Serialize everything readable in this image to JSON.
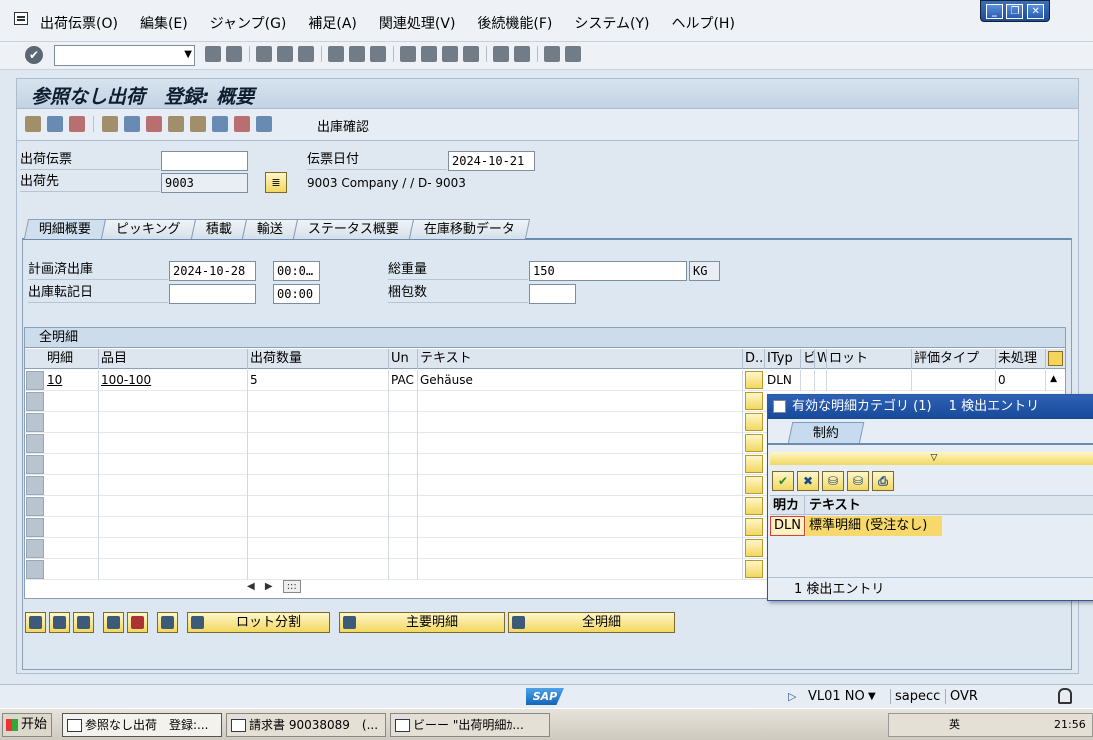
{
  "menu": {
    "items": [
      "出荷伝票(O)",
      "編集(E)",
      "ジャンプ(G)",
      "補足(A)",
      "関連処理(V)",
      "後続機能(F)",
      "システム(Y)",
      "ヘルプ(H)"
    ]
  },
  "window_controls": [
    "_",
    "❐",
    "✕"
  ],
  "page": {
    "title": "参照なし出荷　登録: 概要",
    "app_toolbar_label": "出庫確認"
  },
  "header": {
    "delivery_label": "出荷伝票",
    "delivery_value": "",
    "ship_to_label": "出荷先",
    "ship_to_value": "9003",
    "ship_to_text": "9003 Company / / D- 9003",
    "doc_date_label": "伝票日付",
    "doc_date_value": "2024-10-21"
  },
  "tabs": [
    "明細概要",
    "ピッキング",
    "積載",
    "輸送",
    "ステータス概要",
    "在庫移動データ"
  ],
  "overview": {
    "planned_gi_label": "計画済出庫",
    "planned_gi_date": "2024-10-28",
    "planned_gi_time": "00:0…",
    "actual_gi_label": "出庫転記日",
    "actual_gi_date": "",
    "actual_gi_time": "00:00",
    "total_weight_label": "総重量",
    "total_weight_value": "150",
    "weight_unit": "KG",
    "packages_label": "梱包数",
    "packages_value": ""
  },
  "table": {
    "caption": "全明細",
    "columns": [
      "明細",
      "品目",
      "出荷数量",
      "Un",
      "テキスト",
      "D..",
      "ITyp",
      "ビ",
      "W",
      "ロット",
      "評価タイプ",
      "未処理"
    ],
    "rows": [
      {
        "item": "10",
        "material": "100-100",
        "qty": "5",
        "unit": "PAC",
        "text": "Gehäuse",
        "itype": "DLN",
        "open": "0"
      }
    ],
    "scroll": [
      "◀",
      "▶",
      ":::"
    ],
    "up_arrow": "▲"
  },
  "buttons": {
    "batch_split": "ロット分割",
    "main_items": "主要明細",
    "all_items": "全明細"
  },
  "popup": {
    "title": "有効な明細カテゴリ (1)　 1 検出エントリ",
    "tab": "制約",
    "filter_glyph": "▽",
    "tools": [
      "✔",
      "✖",
      "⛁",
      "⛁",
      "⎙"
    ],
    "col_key": "明カ",
    "col_text": "テキスト",
    "row_key": "DLN",
    "row_text": "標準明細 (受注なし)",
    "status": "1 検出エントリ"
  },
  "statusbar": {
    "sap_logo": "SAP",
    "system": "VL01 NO",
    "client_arrow": "▼",
    "server": "sapecc",
    "mode": "OVR",
    "play_glyph": "▷"
  },
  "taskbar": {
    "start": "开始",
    "tasks": [
      "参照なし出荷　登録:...",
      "請求書 90038089　(...",
      "ビーー \"出荷明細ｶ..."
    ],
    "clock": "21:56",
    "tray_text": "英"
  }
}
